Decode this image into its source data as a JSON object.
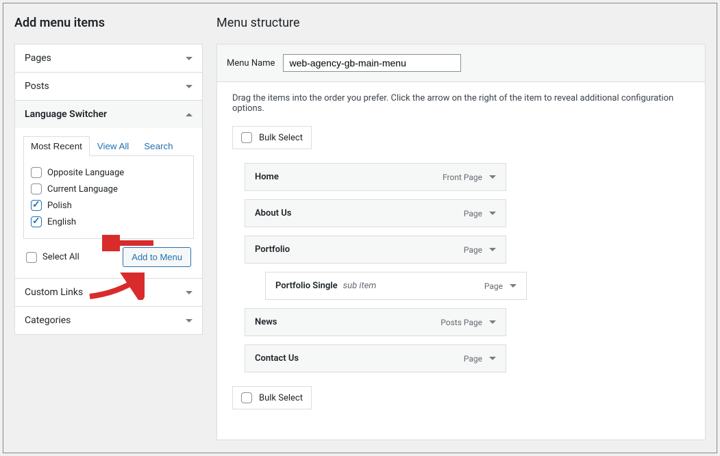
{
  "left": {
    "title": "Add menu items",
    "sections": {
      "pages": "Pages",
      "posts": "Posts",
      "lang": "Language Switcher",
      "custom": "Custom Links",
      "cats": "Categories"
    },
    "tabs": {
      "recent": "Most Recent",
      "viewall": "View All",
      "search": "Search"
    },
    "items": {
      "opposite": "Opposite Language",
      "current": "Current Language",
      "polish": "Polish",
      "english": "English"
    },
    "select_all": "Select All",
    "add_btn": "Add to Menu"
  },
  "right": {
    "title": "Menu structure",
    "name_label": "Menu Name",
    "name_value": "web-agency-gb-main-menu",
    "instructions": "Drag the items into the order you prefer. Click the arrow on the right of the item to reveal additional configuration options.",
    "bulk": "Bulk Select",
    "menu": [
      {
        "label": "Home",
        "type": "Front Page",
        "sub": false
      },
      {
        "label": "About Us",
        "type": "Page",
        "sub": false
      },
      {
        "label": "Portfolio",
        "type": "Page",
        "sub": false
      },
      {
        "label": "Portfolio Single",
        "type": "Page",
        "sub": true,
        "subtext": "sub item"
      },
      {
        "label": "News",
        "type": "Posts Page",
        "sub": false
      },
      {
        "label": "Contact Us",
        "type": "Page",
        "sub": false
      }
    ]
  }
}
